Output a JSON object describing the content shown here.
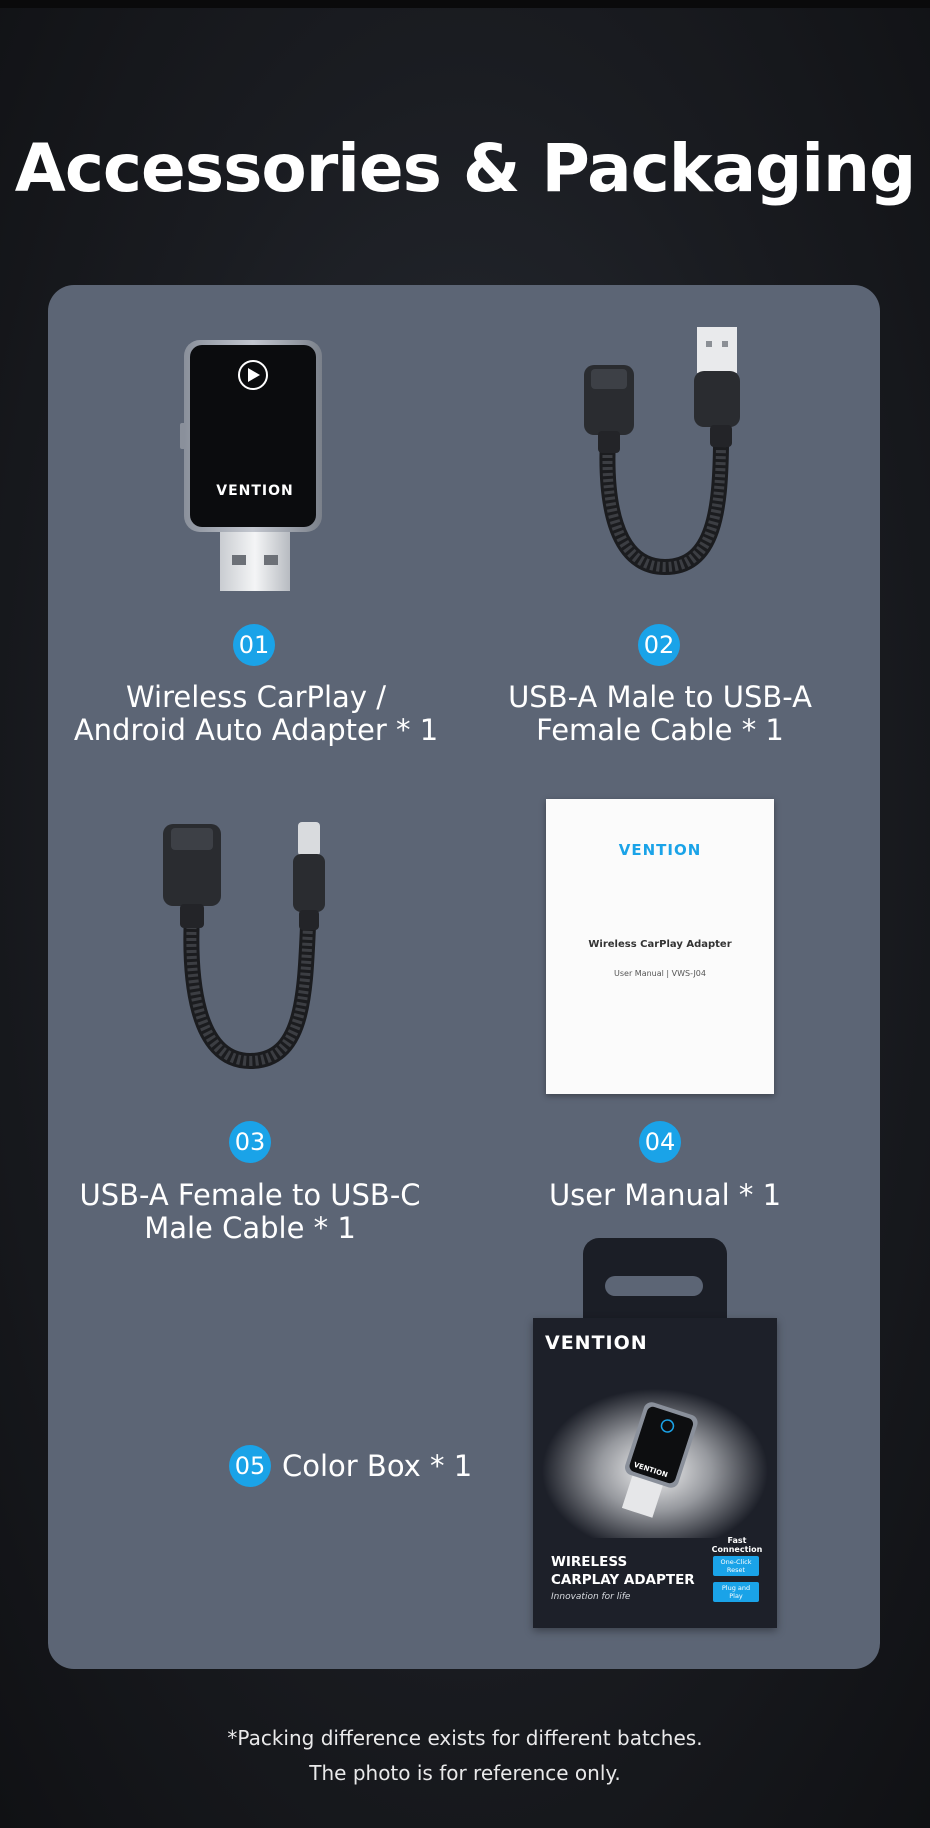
{
  "page": {
    "title": "Accessories & Packaging",
    "footer_line1": "*Packing difference exists for different batches.",
    "footer_line2": "The photo is for reference only."
  },
  "items": [
    {
      "number": "01",
      "label": "Wireless CarPlay /\nAndroid Auto Adapter * 1"
    },
    {
      "number": "02",
      "label": "USB-A Male to USB-A\nFemale Cable * 1"
    },
    {
      "number": "03",
      "label": "USB-A Female to USB-C\nMale Cable * 1"
    },
    {
      "number": "04",
      "label": "User Manual * 1"
    },
    {
      "number": "05",
      "label": "Color Box * 1"
    }
  ],
  "adapter": {
    "brand": "VENTION"
  },
  "manual": {
    "brand": "VENTION",
    "title": "Wireless CarPlay Adapter",
    "subtitle": "User Manual | VWS-J04"
  },
  "box": {
    "brand": "VENTION",
    "product_line1": "WIRELESS",
    "product_line2": "CARPLAY ADAPTER",
    "tagline": "Innovation for life",
    "fast_connection": "Fast\nConnection",
    "feature1": "One-Click\nReset",
    "feature2": "Plug and\nPlay",
    "device_brand": "VENTION"
  },
  "colors": {
    "accent": "#1aa3e8",
    "panel": "#5c6575",
    "background": "#1a1c21"
  }
}
